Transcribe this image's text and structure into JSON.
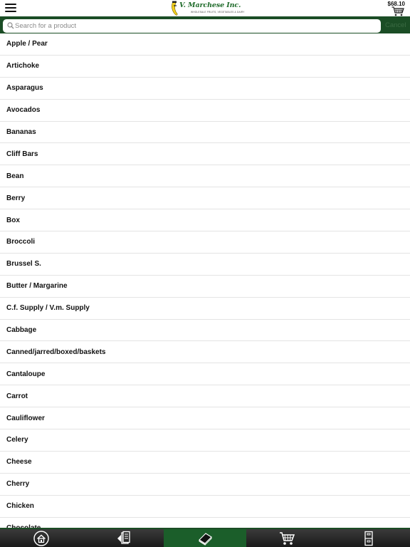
{
  "header": {
    "cart_total": "$68.10",
    "logo_name": "V. Marchese Inc.",
    "logo_tagline": "WHOLESALE FRUITS, VEGETABLES & DAIRY"
  },
  "search": {
    "placeholder": "Search for a product",
    "value": "",
    "cancel_label": "Cancel"
  },
  "products": [
    "Apple / Pear",
    "Artichoke",
    "Asparagus",
    "Avocados",
    "Bananas",
    "Cliff Bars",
    "Bean",
    "Berry",
    "Box",
    "Broccoli",
    "Brussel S.",
    "Butter / Margarine",
    "C.f. Supply / V.m. Supply",
    "Cabbage",
    "Canned/jarred/boxed/baskets",
    "Cantaloupe",
    "Carrot",
    "Cauliflower",
    "Celery",
    "Cheese",
    "Cherry",
    "Chicken",
    "Chocolate"
  ],
  "tabs": [
    {
      "name": "home",
      "icon": "home-icon"
    },
    {
      "name": "orders",
      "icon": "documents-icon"
    },
    {
      "name": "catalog",
      "icon": "book-icon",
      "active": true
    },
    {
      "name": "cart",
      "icon": "cart-icon"
    },
    {
      "name": "more",
      "icon": "cabinet-icon"
    }
  ],
  "colors": {
    "brand_green": "#1b4d25",
    "active_tab": "#1b5e2a"
  }
}
